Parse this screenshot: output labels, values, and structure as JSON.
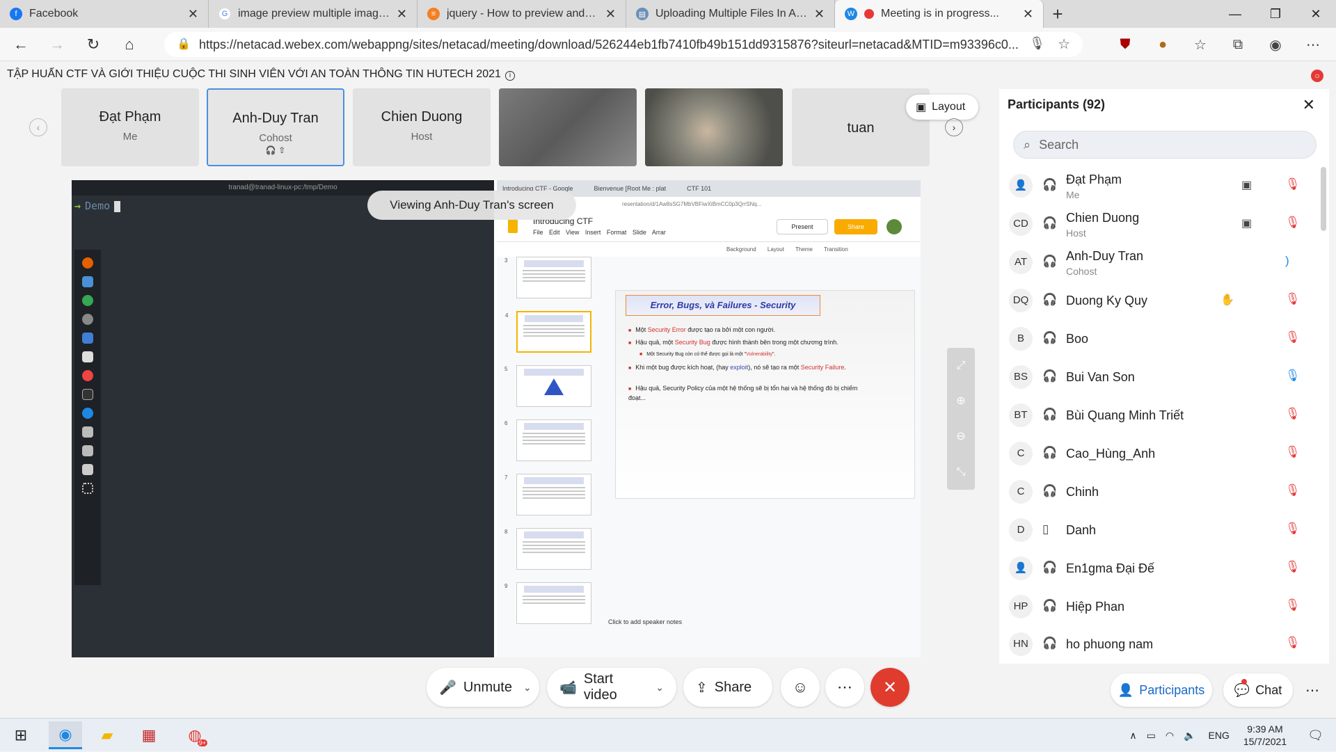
{
  "browser": {
    "tabs": [
      {
        "title": "Facebook",
        "icon": "facebook-icon",
        "color": "#1877f2"
      },
      {
        "title": "image preview multiple image m",
        "icon": "google-icon",
        "color": "#4285f4"
      },
      {
        "title": "jquery - How to preview and the",
        "icon": "stackoverflow-icon",
        "color": "#f48024"
      },
      {
        "title": "Uploading Multiple Files In ASP.N",
        "icon": "page-icon",
        "color": "#6b8fb5"
      },
      {
        "title": "Meeting is in progress...",
        "icon": "webex-icon",
        "color": "#e53935"
      }
    ],
    "url": "https://netacad.webex.com/webappng/sites/netacad/meeting/download/526244eb1fb7410fb49b151dd9315876?siteurl=netacad&MTID=m93396c0..."
  },
  "meeting": {
    "title": "TẬP HUẤN CTF VÀ GIỚI THIỆU CUỘC THI SINH VIÊN VỚI AN TOÀN THÔNG TIN HUTECH 2021",
    "layout_label": "Layout",
    "viewing_label": "Viewing Anh-Duy Tran's screen",
    "tiles": [
      {
        "name": "Đạt Phạm",
        "role": "Me"
      },
      {
        "name": "Anh-Duy Tran",
        "role": "Cohost"
      },
      {
        "name": "Chien Duong",
        "role": "Host"
      },
      {
        "name": "",
        "role": ""
      },
      {
        "name": "",
        "role": ""
      },
      {
        "name": "tuan",
        "role": ""
      }
    ]
  },
  "shared": {
    "terminal_title": "tranad@tranad-linux-pc:/tmp/Demo",
    "terminal_prompt": "Demo",
    "slides_tabs": [
      "Introducing CTF - Google",
      "Bienvenue [Root Me : plat",
      "CTF 101"
    ],
    "slides_url": "resentation/d/1Aw8sSG7MbVBFiwXiBmCC0p3QrrSNq...",
    "doc_title": "Introducing CTF",
    "menu": "File Edit View Insert Format Slide Arrar",
    "present": "Present",
    "share": "Share",
    "toolbar": "Background Layout Theme Transition",
    "slide_title": "Error, Bugs, và Failures - Security",
    "notes": "Click to add speaker notes"
  },
  "controls": {
    "unmute": "Unmute",
    "start_video": "Start video",
    "share": "Share"
  },
  "participants": {
    "title": "Participants (92)",
    "search_placeholder": "Search",
    "list": [
      {
        "initials": "",
        "name": "Đạt Phạm",
        "role": "Me"
      },
      {
        "initials": "CD",
        "name": "Chien Duong",
        "role": "Host"
      },
      {
        "initials": "AT",
        "name": "Anh-Duy Tran",
        "role": "Cohost"
      },
      {
        "initials": "DQ",
        "name": "Duong Ky Quy",
        "role": ""
      },
      {
        "initials": "B",
        "name": "Boo",
        "role": ""
      },
      {
        "initials": "BS",
        "name": "Bui Van Son",
        "role": ""
      },
      {
        "initials": "BT",
        "name": "Bùi Quang Minh Triết",
        "role": ""
      },
      {
        "initials": "C",
        "name": "Cao_Hùng_Anh",
        "role": ""
      },
      {
        "initials": "C",
        "name": "Chinh",
        "role": ""
      },
      {
        "initials": "D",
        "name": "Danh",
        "role": ""
      },
      {
        "initials": "",
        "name": "En1gma Đại Đế",
        "role": ""
      },
      {
        "initials": "HP",
        "name": "Hiệp Phan",
        "role": ""
      },
      {
        "initials": "HN",
        "name": "ho phuong nam",
        "role": ""
      }
    ],
    "tab_participants": "Participants",
    "tab_chat": "Chat"
  },
  "taskbar": {
    "lang": "ENG",
    "time": "9:39 AM",
    "date": "15/7/2021",
    "notif_count": "9+"
  }
}
